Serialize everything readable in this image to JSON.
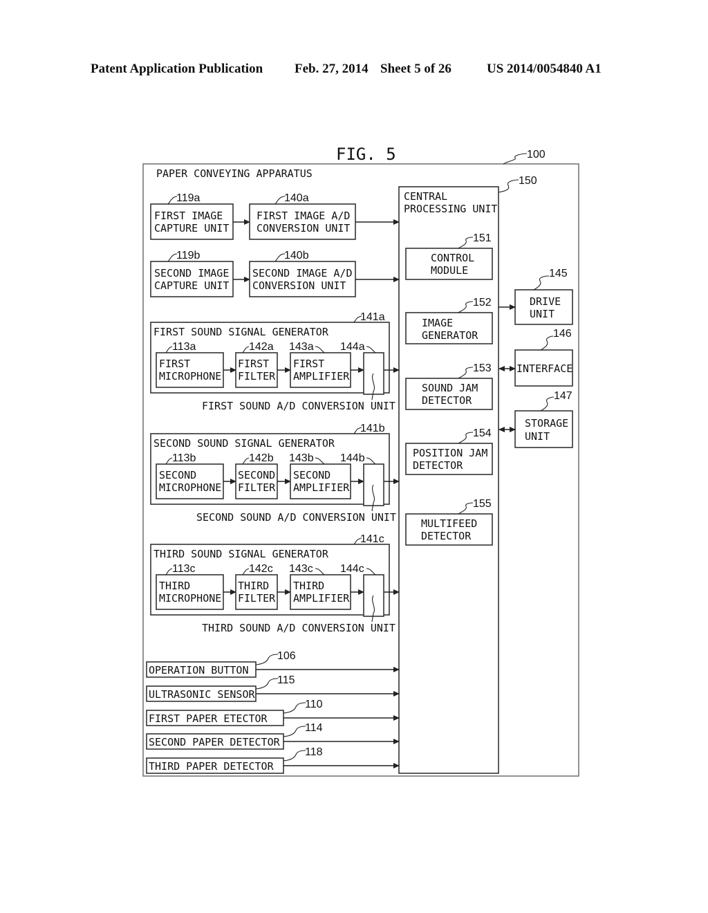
{
  "header": {
    "left": "Patent Application Publication",
    "date": "Feb. 27, 2014",
    "sheet": "Sheet 5 of 26",
    "number": "US 2014/0054840 A1"
  },
  "figure": {
    "title": "FIG. 5",
    "apparatus": {
      "ref": "100",
      "label": "PAPER CONVEYING APPARATUS"
    },
    "image_chain": [
      {
        "capture_ref": "119a",
        "capture_l1": "FIRST IMAGE",
        "capture_l2": "CAPTURE UNIT",
        "ad_ref": "140a",
        "ad_l1": "FIRST IMAGE A/D",
        "ad_l2": "CONVERSION UNIT"
      },
      {
        "capture_ref": "119b",
        "capture_l1": "SECOND IMAGE",
        "capture_l2": "CAPTURE UNIT",
        "ad_ref": "140b",
        "ad_l1": "SECOND IMAGE A/D",
        "ad_l2": "CONVERSION UNIT"
      }
    ],
    "sound_generators": [
      {
        "ref": "141a",
        "title": "FIRST SOUND SIGNAL GENERATOR",
        "mic_ref": "113a",
        "mic_l1": "FIRST",
        "mic_l2": "MICROPHONE",
        "filter_ref": "142a",
        "filter_l1": "FIRST",
        "filter_l2": "FILTER",
        "amp_ref": "143a",
        "amp_l1": "FIRST",
        "amp_l2": "AMPLIFIER",
        "ad_ref": "144a",
        "ad_label": "FIRST SOUND A/D CONVERSION UNIT"
      },
      {
        "ref": "141b",
        "title": "SECOND SOUND SIGNAL GENERATOR",
        "mic_ref": "113b",
        "mic_l1": "SECOND",
        "mic_l2": "MICROPHONE",
        "filter_ref": "142b",
        "filter_l1": "SECOND",
        "filter_l2": "FILTER",
        "amp_ref": "143b",
        "amp_l1": "SECOND",
        "amp_l2": "AMPLIFIER",
        "ad_ref": "144b",
        "ad_label": "SECOND SOUND A/D CONVERSION UNIT"
      },
      {
        "ref": "141c",
        "title": "THIRD SOUND SIGNAL GENERATOR",
        "mic_ref": "113c",
        "mic_l1": "THIRD",
        "mic_l2": "MICROPHONE",
        "filter_ref": "142c",
        "filter_l1": "THIRD",
        "filter_l2": "FILTER",
        "amp_ref": "143c",
        "amp_l1": "THIRD",
        "amp_l2": "AMPLIFIER",
        "ad_ref": "144c",
        "ad_label": "THIRD SOUND A/D CONVERSION UNIT"
      }
    ],
    "inputs": [
      {
        "ref": "106",
        "label": "OPERATION BUTTON"
      },
      {
        "ref": "115",
        "label": "ULTRASONIC SENSOR"
      },
      {
        "ref": "110",
        "label": "FIRST PAPER ETECTOR"
      },
      {
        "ref": "114",
        "label": "SECOND PAPER DETECTOR"
      },
      {
        "ref": "118",
        "label": "THIRD PAPER DETECTOR"
      }
    ],
    "cpu": {
      "ref": "150",
      "l1": "CENTRAL",
      "l2": "PROCESSING UNIT",
      "modules": [
        {
          "ref": "151",
          "l1": "CONTROL",
          "l2": "MODULE"
        },
        {
          "ref": "152",
          "l1": "IMAGE",
          "l2": "GENERATOR"
        },
        {
          "ref": "153",
          "l1": "SOUND JAM",
          "l2": "DETECTOR"
        },
        {
          "ref": "154",
          "l1": "POSITION JAM",
          "l2": "DETECTOR"
        },
        {
          "ref": "155",
          "l1": "MULTIFEED",
          "l2": "DETECTOR"
        }
      ]
    },
    "peripherals": [
      {
        "ref": "145",
        "l1": "DRIVE",
        "l2": "UNIT",
        "link": "output"
      },
      {
        "ref": "146",
        "l1": "INTERFACE",
        "l2": "",
        "link": "bidirectional"
      },
      {
        "ref": "147",
        "l1": "STORAGE",
        "l2": "UNIT",
        "link": "bidirectional"
      }
    ]
  }
}
